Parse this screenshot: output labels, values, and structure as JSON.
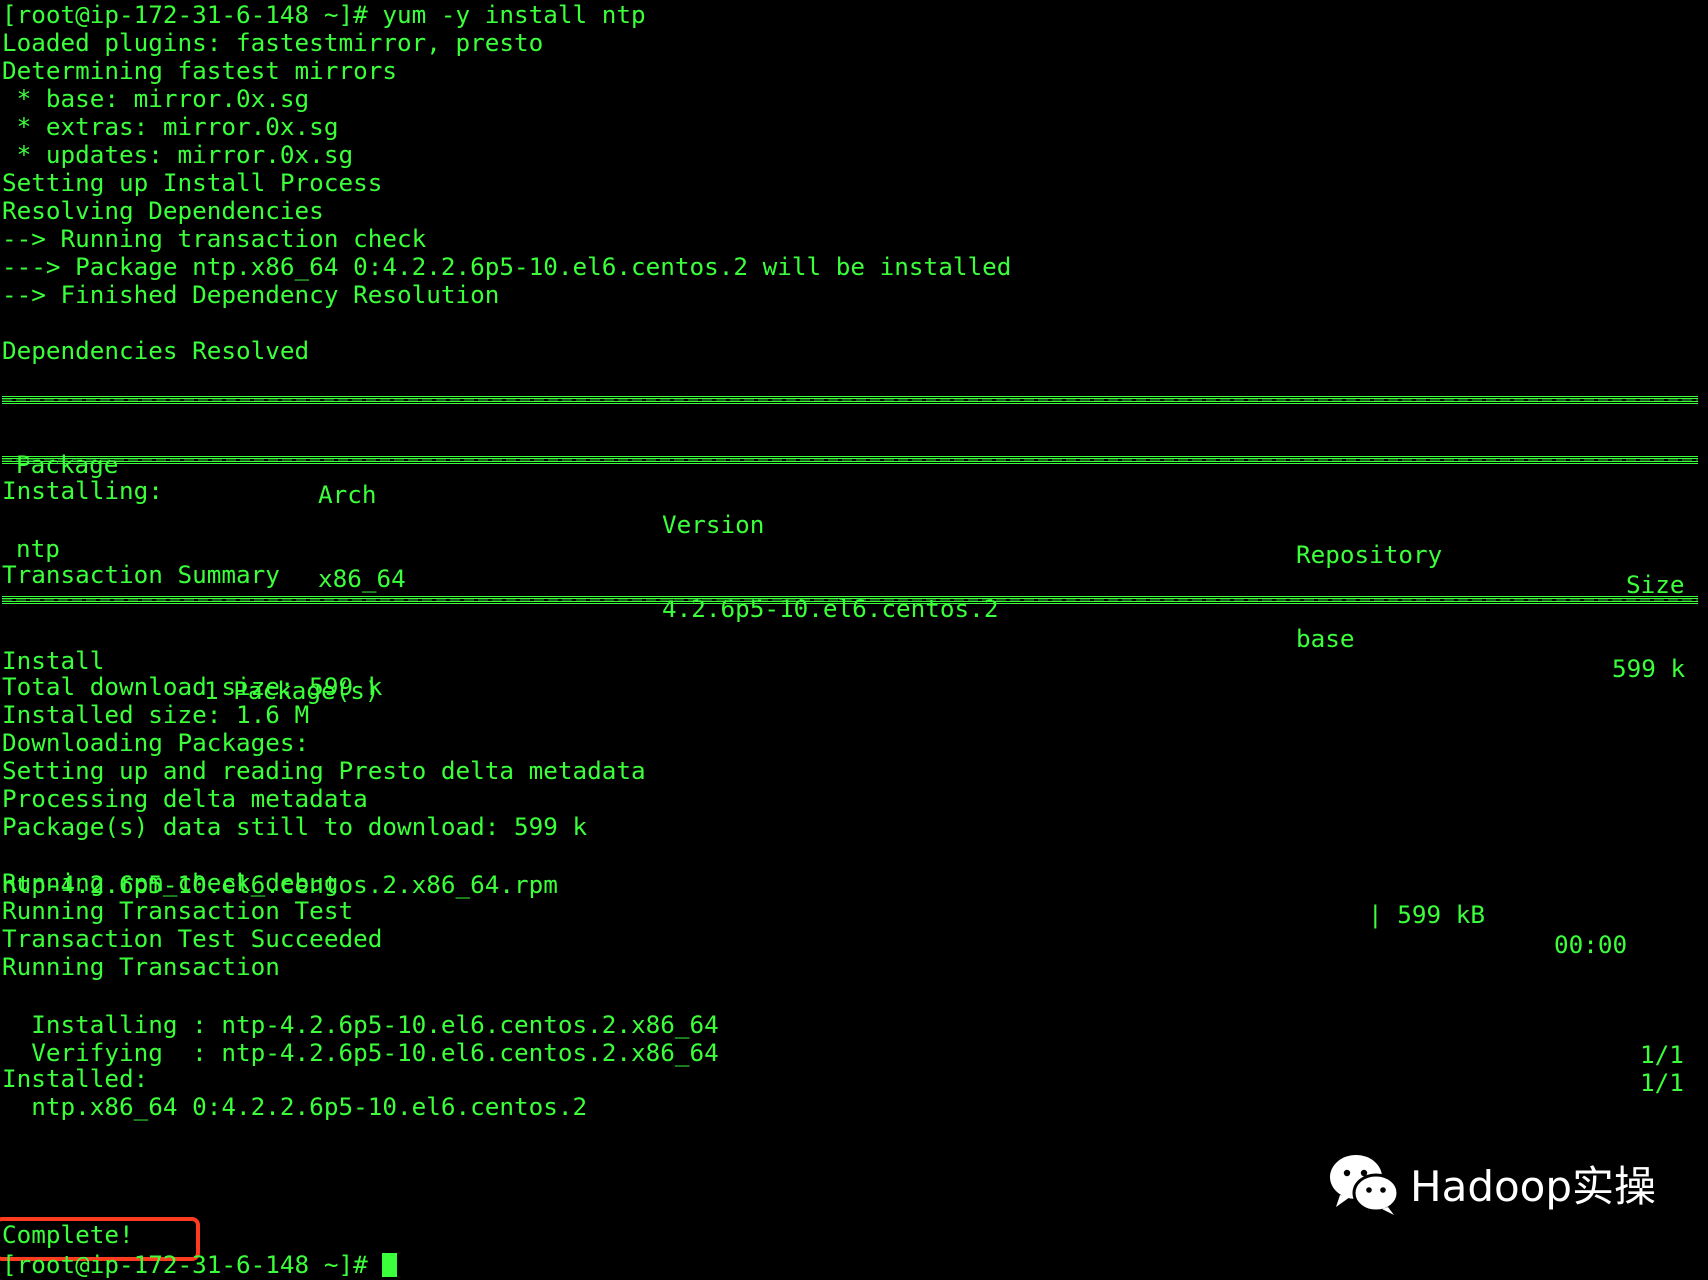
{
  "terminal": {
    "text_color": "#3cff3c",
    "background": "#000000",
    "highlight_color": "#ff3b1f",
    "lines": [
      "[root@ip-172-31-6-148 ~]# yum -y install ntp",
      "Loaded plugins: fastestmirror, presto",
      "Determining fastest mirrors",
      " * base: mirror.0x.sg",
      " * extras: mirror.0x.sg",
      " * updates: mirror.0x.sg",
      "Setting up Install Process",
      "Resolving Dependencies",
      "--> Running transaction check",
      "---> Package ntp.x86_64 0:4.2.2.6p5-10.el6.centos.2 will be installed",
      "--> Finished Dependency Resolution",
      "Dependencies Resolved"
    ],
    "table": {
      "headers": [
        "Package",
        "Arch",
        "Version",
        "Repository",
        "Size"
      ],
      "section_label": "Installing:",
      "rows": [
        [
          "ntp",
          "x86_64",
          "4.2.6p5-10.el6.centos.2",
          "base",
          "599 k"
        ]
      ]
    },
    "summary": {
      "title": "Transaction Summary",
      "install_label": "Install",
      "install_count": "1 Package(s)"
    },
    "lines_after": [
      "Total download size: 599 k",
      "Installed size: 1.6 M",
      "Downloading Packages:",
      "Setting up and reading Presto delta metadata",
      "Processing delta metadata",
      "Package(s) data still to download: 599 k"
    ],
    "download": {
      "file": "ntp-4.2.6p5-10.el6.centos.2.x86_64.rpm",
      "size": "| 599 kB",
      "time": "00:00"
    },
    "lines_run": [
      "Running rpm_check_debug",
      "Running Transaction Test",
      "Transaction Test Succeeded",
      "Running Transaction"
    ],
    "steps": [
      {
        "label": "  Installing : ntp-4.2.6p5-10.el6.centos.2.x86_64",
        "progress": "1/1"
      },
      {
        "label": "  Verifying  : ntp-4.2.6p5-10.el6.centos.2.x86_64",
        "progress": "1/1"
      }
    ],
    "installed": {
      "title": "Installed:",
      "package": "  ntp.x86_64 0:4.2.2.6p5-10.el6.centos.2"
    },
    "complete": "Complete!",
    "prompt": "[root@ip-172-31-6-148 ~]# "
  },
  "watermark": {
    "icon": "wechat-icon",
    "text": "Hadoop实操"
  }
}
